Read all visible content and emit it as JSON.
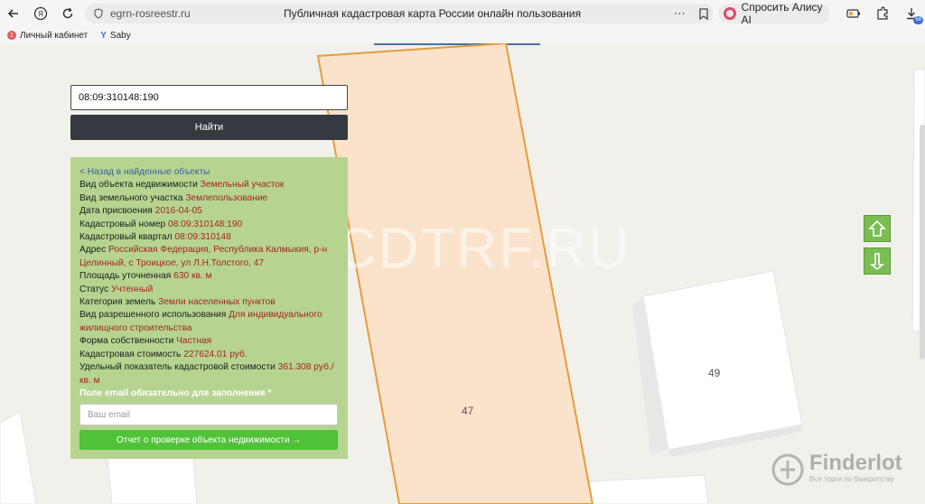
{
  "browser": {
    "url": "egrn-rosreestr.ru",
    "page_title": "Публичная кадастровая карта России онлайн пользования",
    "alice_label": "Спросить Алису AI",
    "download_badge": "68",
    "bookmarks": [
      {
        "label": "Личный кабинет",
        "badge": "1"
      },
      {
        "label": "Saby"
      }
    ]
  },
  "search": {
    "value": "08:09:310148:190",
    "button_label": "Найти"
  },
  "panel": {
    "back_link": "< Назад в найденные объекты",
    "fields": [
      {
        "label": "Вид объекта недвижимости",
        "value": "Земельный участок"
      },
      {
        "label": "Вид земельного участка",
        "value": "Землепользование"
      },
      {
        "label": "Дата присвоения",
        "value": "2016-04-05"
      },
      {
        "label": "Кадастровый номер",
        "value": "08:09:310148:190"
      },
      {
        "label": "Кадастровый квартал",
        "value": "08:09:310148"
      },
      {
        "label": "Адрес",
        "value": "Российская Федерация, Республика Калмыкия, р-н Целинный, с Троицкое, ул Л.Н.Толстого, 47"
      },
      {
        "label": "Площадь уточненная",
        "value": "630 кв. м"
      },
      {
        "label": "Статус",
        "value": "Учтенный"
      },
      {
        "label": "Категория земель",
        "value": "Земли населенных пунктов"
      },
      {
        "label": "Вид разрешенного использования",
        "value": "Для индивидуального жилищного строительства"
      },
      {
        "label": "Форма собственности",
        "value": "Частная"
      },
      {
        "label": "Кадастровая стоимость",
        "value": "227624.01 руб."
      },
      {
        "label": "Удельный показатель кадастровой стоимости",
        "value": "361.308 руб./кв. м"
      }
    ],
    "email_label": "Поле email обязательно для заполнения *",
    "email_placeholder": "Ваш email",
    "report_button": "Отчет о проверке объекта недвижимости →"
  },
  "map": {
    "parcel_label_47": "47",
    "parcel_label_49": "49",
    "parcel_fill": "#fbe3cb",
    "parcel_stroke": "#e89a3c"
  },
  "watermarks": {
    "cdtrf": "CDTRF.RU",
    "finderlot": "Finderlot",
    "finderlot_sub": "Все торги по банкротству"
  }
}
